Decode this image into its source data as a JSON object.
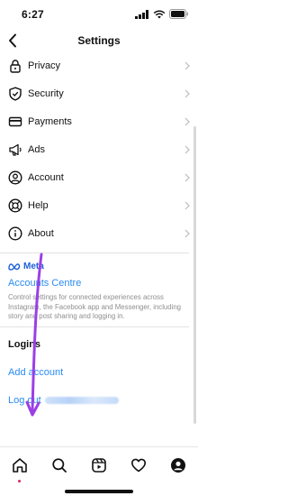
{
  "status_bar": {
    "time": "6:27"
  },
  "nav": {
    "title": "Settings"
  },
  "settings_items": [
    {
      "label": "Privacy",
      "icon": "lock-icon"
    },
    {
      "label": "Security",
      "icon": "shield-icon"
    },
    {
      "label": "Payments",
      "icon": "card-icon"
    },
    {
      "label": "Ads",
      "icon": "megaphone-icon"
    },
    {
      "label": "Account",
      "icon": "person-icon"
    },
    {
      "label": "Help",
      "icon": "lifebuoy-icon"
    },
    {
      "label": "About",
      "icon": "info-icon"
    }
  ],
  "meta": {
    "logo_text": "Meta",
    "accounts_centre": "Accounts Centre",
    "description": "Control settings for connected experiences across Instagram, the Facebook app and Messenger, including story and post sharing and logging in."
  },
  "logins": {
    "title": "Logins",
    "add_account": "Add account",
    "log_out": "Log out"
  },
  "colors": {
    "accent": "#2a8bf2",
    "meta_blue": "#1c5fd6",
    "annotation_arrow": "#9b3fe6"
  },
  "tabs": [
    {
      "icon": "home-icon",
      "active": true
    },
    {
      "icon": "search-icon",
      "active": false
    },
    {
      "icon": "reels-icon",
      "active": false
    },
    {
      "icon": "heart-icon",
      "active": false
    },
    {
      "icon": "profile-icon",
      "active": false
    }
  ]
}
